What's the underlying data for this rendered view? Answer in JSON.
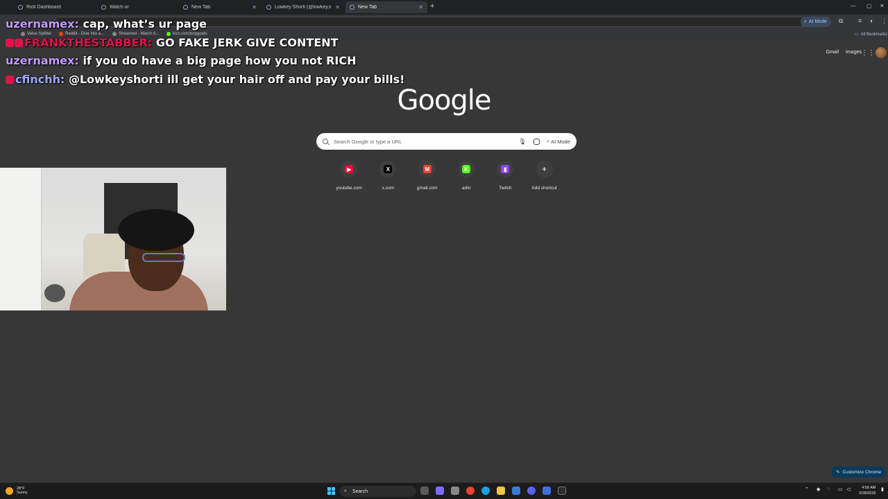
{
  "tabs": [
    {
      "title": "Rick Dashboard",
      "active": false
    },
    {
      "title": "Watch or",
      "active": false
    },
    {
      "title": "New Tab",
      "active": false
    },
    {
      "title": "Lowkey Shorti (@lowkey.shorti)",
      "active": false
    },
    {
      "title": "New Tab",
      "active": true
    }
  ],
  "toolbar": {
    "ai_mode": "AI Mode"
  },
  "bookmarks": {
    "items": [
      "Value Splitter",
      "Reddit - Dive into a...",
      "Streamed - Watch A...",
      "kick.com/popgoats"
    ],
    "all_bookmarks": "All Bookmarks"
  },
  "chat": [
    {
      "user": "uzernamex:",
      "user_color": "#c39bff",
      "text": "cap, what’s ur page",
      "badges": []
    },
    {
      "user": "FRANKTHESTABBER:",
      "user_color": "#e0124b",
      "text": "GO FAKE JERK GIVE CONTENT",
      "badges": [
        "#e0124b",
        "#e0124b"
      ]
    },
    {
      "user": "uzernamex:",
      "user_color": "#c39bff",
      "text": "if you do have a big page how you not RICH",
      "badges": []
    },
    {
      "user": "cfinchh:",
      "user_color": "#9ea7ff",
      "text": "@Lowkeyshorti ill get your hair off and pay your bills!",
      "badges": [
        "#e0124b"
      ]
    }
  ],
  "ntp": {
    "gmail": "Gmail",
    "images": "Images",
    "logo": "Google",
    "search_placeholder": "Search Google or type a URL",
    "ai_mode": "AI Mode",
    "shortcuts": [
      {
        "label": "youtube.com",
        "icon": "youtube-icon",
        "color": "#ff0033",
        "glyph": "▶"
      },
      {
        "label": "x.com",
        "icon": "x-icon",
        "color": "#000000",
        "glyph": "X"
      },
      {
        "label": "gmail.com",
        "icon": "gmail-icon",
        "color": "#ea4335",
        "glyph": "M"
      },
      {
        "label": "adin",
        "icon": "kick-icon",
        "color": "#53fc18",
        "glyph": "K"
      },
      {
        "label": "Twitch",
        "icon": "twitch-icon",
        "color": "#9146ff",
        "glyph": "▮"
      },
      {
        "label": "Add shortcut",
        "icon": "plus-icon",
        "color": "#3f3f3f",
        "glyph": "+"
      }
    ],
    "customize": "Customize Chrome"
  },
  "taskbar": {
    "temp": "28°F",
    "condition": "Sunny",
    "search": "Search",
    "time": "4:56 AM",
    "date": "3/28/2026"
  }
}
